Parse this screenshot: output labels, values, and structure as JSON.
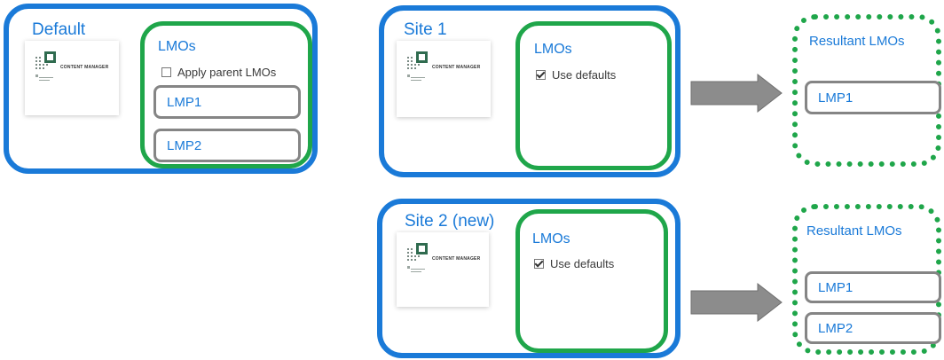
{
  "default_panel": {
    "title": "Default",
    "lmos_label": "LMOs",
    "option_label": "Apply parent LMOs",
    "option_checked": false,
    "lmps": [
      "LMP1",
      "LMP2"
    ]
  },
  "site1_panel": {
    "title": "Site 1",
    "lmos_label": "LMOs",
    "option_label": "Use defaults",
    "option_checked": true
  },
  "site2_panel": {
    "title": "Site 2 (new)",
    "lmos_label": "LMOs",
    "option_label": "Use defaults",
    "option_checked": true
  },
  "result1": {
    "title": "Resultant LMOs",
    "lmps": [
      "LMP1"
    ]
  },
  "result2": {
    "title": "Resultant LMOs",
    "lmps": [
      "LMP1",
      "LMP2"
    ]
  },
  "logo": {
    "text": "CONTENT MANAGER",
    "icon": "content-manager-logo-icon"
  },
  "colors": {
    "blue_border": "#1a7ad8",
    "green_border": "#1fa64a",
    "lmp_border": "#858585",
    "arrow_fill": "#8c8c8c",
    "logo_green": "#2f6b4f"
  }
}
